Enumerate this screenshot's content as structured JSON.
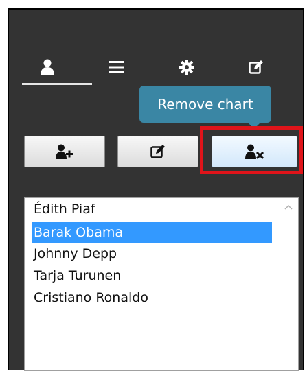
{
  "nav": {
    "tabs": [
      {
        "icon": "user-icon",
        "active": true
      },
      {
        "icon": "list-icon",
        "active": false
      },
      {
        "icon": "gear-icon",
        "active": false
      },
      {
        "icon": "edit-icon",
        "active": false
      }
    ]
  },
  "tooltip": {
    "text": "Remove chart"
  },
  "actions": {
    "buttons": [
      {
        "icon": "user-add-icon"
      },
      {
        "icon": "edit-icon"
      },
      {
        "icon": "user-remove-icon",
        "active": true
      }
    ]
  },
  "list": {
    "items": [
      "Édith Piaf",
      "Barak Obama",
      "Johnny Depp",
      "Tarja Turunen",
      "Cristiano Ronaldo"
    ],
    "selected_index": 1
  },
  "colors": {
    "panel_bg": "#333333",
    "tooltip_bg": "#3a86a4",
    "selection_bg": "#3399ff",
    "highlight_border": "#e0141a"
  }
}
